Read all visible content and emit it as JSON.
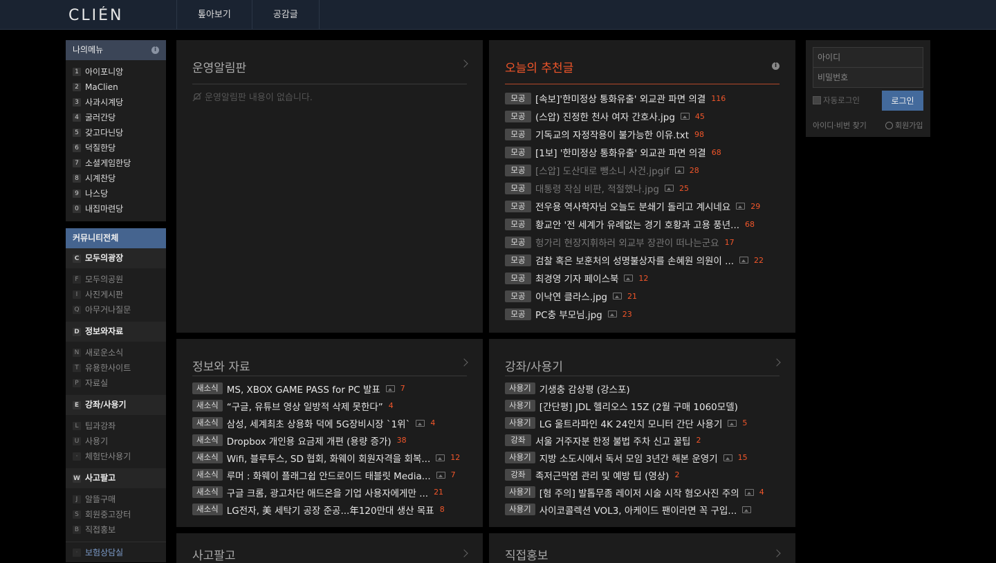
{
  "brand": {
    "logo_text": "CLIÉN"
  },
  "topnav": [
    "톺아보기",
    "공감글"
  ],
  "my_menu": {
    "title": "나의메뉴",
    "items": [
      {
        "key": "1",
        "label": "아이포니앙"
      },
      {
        "key": "2",
        "label": "MaClien"
      },
      {
        "key": "3",
        "label": "사과시계당"
      },
      {
        "key": "4",
        "label": "굴러간당"
      },
      {
        "key": "5",
        "label": "갖고다닌당"
      },
      {
        "key": "6",
        "label": "덕질한당"
      },
      {
        "key": "7",
        "label": "소셜게임한당"
      },
      {
        "key": "8",
        "label": "시계찬당"
      },
      {
        "key": "9",
        "label": "나스당"
      },
      {
        "key": "0",
        "label": "내집마련당"
      }
    ]
  },
  "community": {
    "title": "커뮤니티전체",
    "categories": [
      {
        "key": "C",
        "label": "모두의광장",
        "subs": [
          {
            "key": "F",
            "label": "모두의공원"
          },
          {
            "key": "I",
            "label": "사진게시판"
          },
          {
            "key": "Q",
            "label": "아무거나질문"
          }
        ]
      },
      {
        "key": "D",
        "label": "정보와자료",
        "subs": [
          {
            "key": "N",
            "label": "새로운소식"
          },
          {
            "key": "T",
            "label": "유용한사이트"
          },
          {
            "key": "P",
            "label": "자료실"
          }
        ]
      },
      {
        "key": "E",
        "label": "강좌/사용기",
        "subs": [
          {
            "key": "L",
            "label": "팁과강좌"
          },
          {
            "key": "U",
            "label": "사용기"
          },
          {
            "key": "·",
            "label": "체험단사용기"
          }
        ]
      },
      {
        "key": "W",
        "label": "사고팔고",
        "subs": [
          {
            "key": "J",
            "label": "알뜰구매"
          },
          {
            "key": "S",
            "label": "회원중고장터"
          },
          {
            "key": "B",
            "label": "직접홍보"
          }
        ]
      }
    ],
    "last": {
      "key": "·",
      "label": "보험상담실"
    }
  },
  "notice_panel": {
    "title": "운영알림판",
    "empty": "운영알림판 내용이 없습니다."
  },
  "recommend_panel": {
    "title": "오늘의 추천글",
    "rows": [
      {
        "tag": "모공",
        "text": "[속보]'한미정상 통화유출' 외교관 파면 의결",
        "img": false,
        "count": "116",
        "dim": false
      },
      {
        "tag": "모공",
        "text": "(스압) 진정한 천사 여자 간호사.jpg",
        "img": true,
        "count": "45",
        "dim": false
      },
      {
        "tag": "모공",
        "text": "기독교의 자정작용이 불가능한 이유.txt",
        "img": false,
        "count": "98",
        "dim": false
      },
      {
        "tag": "모공",
        "text": "[1보] '한미정상 통화유출' 외교관 파면 의결",
        "img": false,
        "count": "68",
        "dim": false
      },
      {
        "tag": "모공",
        "text": "[스압] 도산대로 뺑소니 사건.jpgif",
        "img": true,
        "count": "28",
        "dim": true
      },
      {
        "tag": "모공",
        "text": "대통령 작심 비판, 적절했나.jpg",
        "img": true,
        "count": "25",
        "dim": true
      },
      {
        "tag": "모공",
        "text": "전우용 역사학자님 오늘도 분쇄기 돌리고 계시네요",
        "img": true,
        "count": "29",
        "dim": false
      },
      {
        "tag": "모공",
        "text": "황교안 '전 세계가 유례없는 경기 호황과 고용 풍년...",
        "img": false,
        "count": "68",
        "dim": false
      },
      {
        "tag": "모공",
        "text": "헝가리 현장지휘하러 외교부 장관이 떠나는군요",
        "img": false,
        "count": "17",
        "dim": true
      },
      {
        "tag": "모공",
        "text": "검찰 혹은 보훈처의 성명불상자를 손혜원 의원이 ...",
        "img": true,
        "count": "22",
        "dim": false
      },
      {
        "tag": "모공",
        "text": "최경영 기자 페이스북",
        "img": true,
        "count": "12",
        "dim": false
      },
      {
        "tag": "모공",
        "text": "이낙연 클라스.jpg",
        "img": true,
        "count": "21",
        "dim": false
      },
      {
        "tag": "모공",
        "text": "PC충 부모님.jpg",
        "img": true,
        "count": "23",
        "dim": false
      }
    ]
  },
  "info_panel": {
    "title": "정보와 자료",
    "rows": [
      {
        "tag": "새소식",
        "text": "MS, XBOX GAME PASS for PC 발표",
        "img": true,
        "count": "7"
      },
      {
        "tag": "새소식",
        "text": "“구글, 유튜브 영상 일방적 삭제 못한다”",
        "img": false,
        "count": "4"
      },
      {
        "tag": "새소식",
        "text": "삼성, 세계최초 상용화 덕에 5G장비시장 `1위`",
        "img": true,
        "count": "4"
      },
      {
        "tag": "새소식",
        "text": "Dropbox 개인용 요금제 개편 (용량 증가)",
        "img": false,
        "count": "38"
      },
      {
        "tag": "새소식",
        "text": "Wifi, 블루투스, SD 협회, 화웨이 회원자격을 회복...",
        "img": true,
        "count": "12"
      },
      {
        "tag": "새소식",
        "text": "루머 : 화웨이 플래그쉽 안드로이드 태블릿 Media...",
        "img": true,
        "count": "7"
      },
      {
        "tag": "새소식",
        "text": "구글 크롬, 광고차단 애드온을 기업 사용자에게만 ...",
        "img": false,
        "count": "21"
      },
      {
        "tag": "새소식",
        "text": "LG전자, 美 세탁기 공장 준공...年120만대 생산 목표",
        "img": false,
        "count": "8"
      }
    ]
  },
  "lecture_panel": {
    "title": "강좌/사용기",
    "rows": [
      {
        "tag": "사용기",
        "text": "기생충 감상평 (강스포)",
        "img": false,
        "count": ""
      },
      {
        "tag": "사용기",
        "text": "[간단평] JDL 헬리오스 15Z (2월 구매 1060모델)",
        "img": false,
        "count": ""
      },
      {
        "tag": "사용기",
        "text": "LG 울트라파인 4K 24인치 모니터 간단 사용기",
        "img": true,
        "count": "5"
      },
      {
        "tag": "강좌",
        "text": "서울 거주자분 한정 불법 주차 신고 꿀팁",
        "img": false,
        "count": "2"
      },
      {
        "tag": "사용기",
        "text": "지방 소도시에서 독서 모임 3년간 해본 운영기",
        "img": true,
        "count": "15"
      },
      {
        "tag": "강좌",
        "text": "족저근막염 관리 및 예방 팁 (영상)",
        "img": false,
        "count": "2"
      },
      {
        "tag": "사용기",
        "text": "[혐 주의] 발톱무좀 레이저 시술 시작 혐오사진 주의",
        "img": true,
        "count": "4"
      },
      {
        "tag": "사용기",
        "text": "사이코콜렉션 VOL3, 아케이드 팬이라면 꼭 구입...",
        "img": true,
        "count": ""
      }
    ]
  },
  "sell_panel": {
    "title": "사고팔고"
  },
  "promo_panel": {
    "title": "직접홍보"
  },
  "login": {
    "id_placeholder": "아이디",
    "pw_placeholder": "비밀번호",
    "auto_login": "자동로그인",
    "login_button": "로그인",
    "find_link": "아이디·비번 찾기",
    "join_link": "회원가입"
  }
}
